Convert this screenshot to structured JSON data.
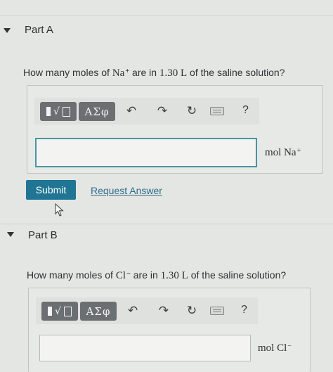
{
  "partA": {
    "title": "Part A",
    "question": {
      "prefix": "How many moles of ",
      "species": "Na",
      "charge": "+",
      "middle": " are in ",
      "volume": "1.30 L",
      "suffix": " of the saline solution?"
    },
    "answer_value": "",
    "unit": {
      "label": "mol Na",
      "charge": "+"
    }
  },
  "partB": {
    "title": "Part B",
    "question": {
      "prefix": "How many moles of ",
      "species": "Cl",
      "charge": "−",
      "middle": " are in ",
      "volume": "1.30 L",
      "suffix": " of the saline solution?"
    },
    "answer_value": "",
    "unit": {
      "label": "mol Cl",
      "charge": "−"
    }
  },
  "toolbar": {
    "templates_icon": "templates-icon",
    "symbols_label": "ΑΣφ",
    "undo_glyph": "↶",
    "redo_glyph": "↷",
    "reset_glyph": "↻",
    "keyboard_icon": "keyboard-icon",
    "help_label": "?"
  },
  "actions": {
    "submit_label": "Submit",
    "request_answer_label": "Request Answer"
  },
  "colors": {
    "background": "#e4e6e3",
    "submit": "#1f7593",
    "link": "#2f6b8c",
    "focus_border": "#4a93a3",
    "toolbar_button": "#6b6f72"
  }
}
